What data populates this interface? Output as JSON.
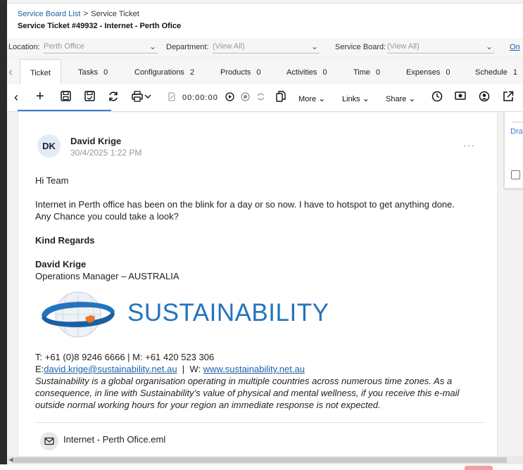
{
  "breadcrumb": {
    "parent": "Service Board List",
    "separator": ">",
    "current": "Service Ticket"
  },
  "ticket_title": "Service Ticket #49932 - Internet - Perth Ofice",
  "filters": {
    "location_label": "Location:",
    "location_value": "Perth Office",
    "department_label": "Department:",
    "department_value": "(View All)",
    "board_label": "Service Board:",
    "board_value": "(View All)",
    "on_link": "On"
  },
  "tabs": [
    {
      "label": "Ticket",
      "count": ""
    },
    {
      "label": "Tasks",
      "count": "0"
    },
    {
      "label": "Configurations",
      "count": "2"
    },
    {
      "label": "Products",
      "count": "0"
    },
    {
      "label": "Activities",
      "count": "0"
    },
    {
      "label": "Time",
      "count": "0"
    },
    {
      "label": "Expenses",
      "count": "0"
    },
    {
      "label": "Schedule",
      "count": "1"
    }
  ],
  "toolbar": {
    "timer": "00:00:00",
    "more": "More",
    "links": "Links",
    "share": "Share"
  },
  "right_panel": {
    "label": "Dra"
  },
  "message": {
    "initials": "DK",
    "sender": "David Krige",
    "date": "30/4/2025 1:22 PM",
    "greeting": "Hi Team",
    "body_line1": "Internet in Perth office has been on the blink for a day or so now. I have to hotspot to get anything done.",
    "body_line2": "Any Chance you could take a look?",
    "regards": "Kind Regards",
    "sig_name": "David Krige",
    "sig_title": "Operations Manager – AUSTRALIA",
    "logo_text": "SUSTAINABILITY",
    "phone_line": "T: +61 (0)8 9246 6666  |  M: +61 420 523 306",
    "email_prefix": "E:",
    "email": "david.krige@sustainability.net.au",
    "web_sep": "  |  W: ",
    "website": "www.sustainability.net.au",
    "disclaimer_line1": "Sustainability is a global organisation operating in multiple countries across numerous time zones. As a",
    "disclaimer_line2": "consequence, in line with Sustainability’s value of physical and mental wellness, if you receive this e-mail",
    "disclaimer_line3": "outside normal working hours for your region an immediate response is not expected."
  },
  "attachment": {
    "name": "Internet - Perth Ofice.eml"
  },
  "colors": {
    "accent": "#3a7bd5",
    "link": "#1f5fa8",
    "brand": "#2474bd"
  }
}
